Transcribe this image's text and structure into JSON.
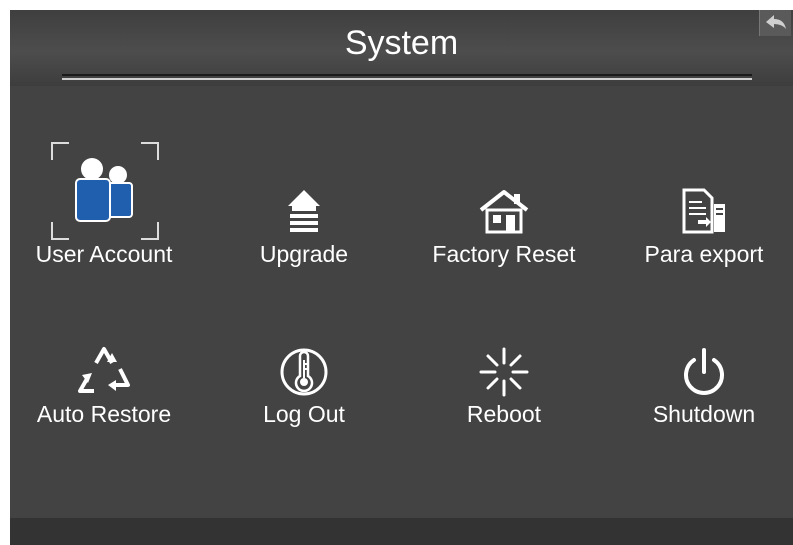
{
  "header": {
    "title": "System",
    "back_icon": "back-arrow-icon"
  },
  "menu": [
    {
      "label": "User Account",
      "icon": "user-account-icon",
      "selected": true
    },
    {
      "label": "Upgrade",
      "icon": "upgrade-icon"
    },
    {
      "label": "Factory Reset",
      "icon": "house-icon"
    },
    {
      "label": "Para export",
      "icon": "export-document-icon"
    },
    {
      "label": "Auto Restore",
      "icon": "recycle-icon"
    },
    {
      "label": "Log Out",
      "icon": "thermometer-key-icon"
    },
    {
      "label": "Reboot",
      "icon": "loading-spinner-icon"
    },
    {
      "label": "Shutdown",
      "icon": "power-icon"
    }
  ],
  "colors": {
    "background": "#434343",
    "header": "#4a4a4a",
    "footer": "#333333",
    "accent": "#1f5fad",
    "text": "#ffffff"
  }
}
